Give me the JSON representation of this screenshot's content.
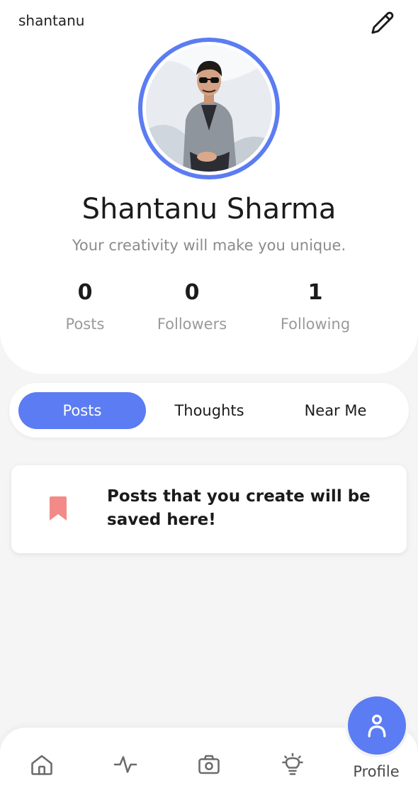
{
  "header": {
    "username": "shantanu",
    "edit_icon": "pencil-icon"
  },
  "profile": {
    "full_name": "Shantanu Sharma",
    "bio": "Your creativity will make you unique.",
    "avatar_alt": "profile photo",
    "ring_color": "#5b7cf2"
  },
  "stats": {
    "posts": {
      "value": "0",
      "label": "Posts"
    },
    "followers": {
      "value": "0",
      "label": "Followers"
    },
    "following": {
      "value": "1",
      "label": "Following"
    }
  },
  "tabs": [
    {
      "label": "Posts",
      "active": true
    },
    {
      "label": "Thoughts",
      "active": false
    },
    {
      "label": "Near Me",
      "active": false
    }
  ],
  "empty_state": {
    "icon": "bookmark-icon",
    "icon_color": "#f28b87",
    "message": "Posts that you create will be saved here!"
  },
  "bottom_nav": {
    "items": [
      {
        "icon": "home-icon"
      },
      {
        "icon": "activity-icon"
      },
      {
        "icon": "camera-icon"
      },
      {
        "icon": "lightbulb-icon"
      }
    ],
    "active": {
      "icon": "person-icon",
      "label": "Profile"
    }
  },
  "colors": {
    "accent": "#5b7cf2",
    "background": "#f5f5f5",
    "card": "#ffffff"
  }
}
